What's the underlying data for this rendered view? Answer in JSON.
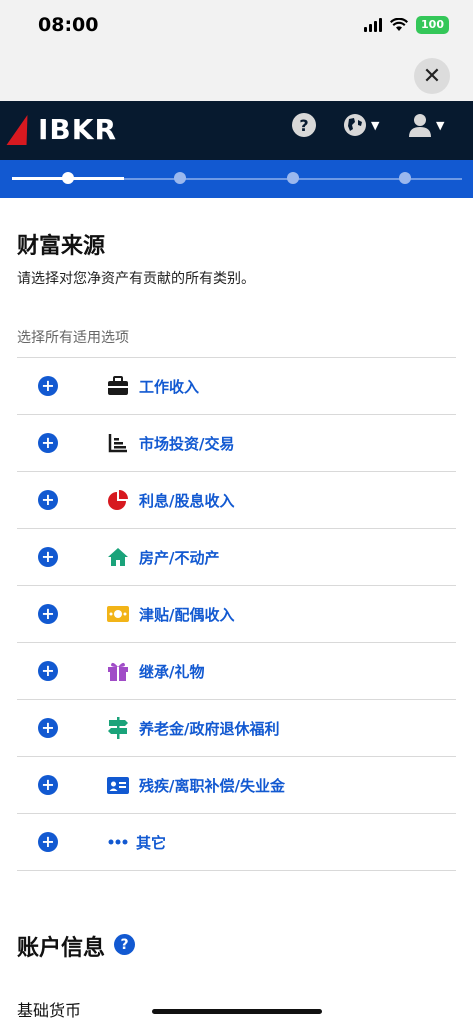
{
  "status_bar": {
    "time": "08:00",
    "battery": "100"
  },
  "header": {
    "logo_text": "IBKR"
  },
  "content": {
    "title": "财富来源",
    "subtitle": "请选择对您净资产有贡献的所有类别。",
    "select_hint": "选择所有适用选项"
  },
  "sources": [
    {
      "label": "工作收入",
      "icon": "briefcase-icon",
      "color": "#1a1a1a"
    },
    {
      "label": "市场投资/交易",
      "icon": "chart-icon",
      "color": "#1a1a1a"
    },
    {
      "label": "利息/股息收入",
      "icon": "pie-chart-icon",
      "color": "#d71920"
    },
    {
      "label": "房产/不动产",
      "icon": "house-icon",
      "color": "#1aa37a"
    },
    {
      "label": "津贴/配偶收入",
      "icon": "money-icon",
      "color": "#f2b418"
    },
    {
      "label": "继承/礼物",
      "icon": "gift-icon",
      "color": "#a04cc7"
    },
    {
      "label": "养老金/政府退休福利",
      "icon": "signpost-icon",
      "color": "#1aa37a"
    },
    {
      "label": "残疾/离职补偿/失业金",
      "icon": "id-card-icon",
      "color": "#1259d1"
    },
    {
      "label": "其它",
      "icon": "ellipsis-icon",
      "color": "#1259d1"
    }
  ],
  "account_info": {
    "title": "账户信息",
    "base_currency_label": "基础货币"
  },
  "colors": {
    "header_bg": "#071a2f",
    "accent": "#1259d1",
    "brand_red": "#d71920"
  }
}
